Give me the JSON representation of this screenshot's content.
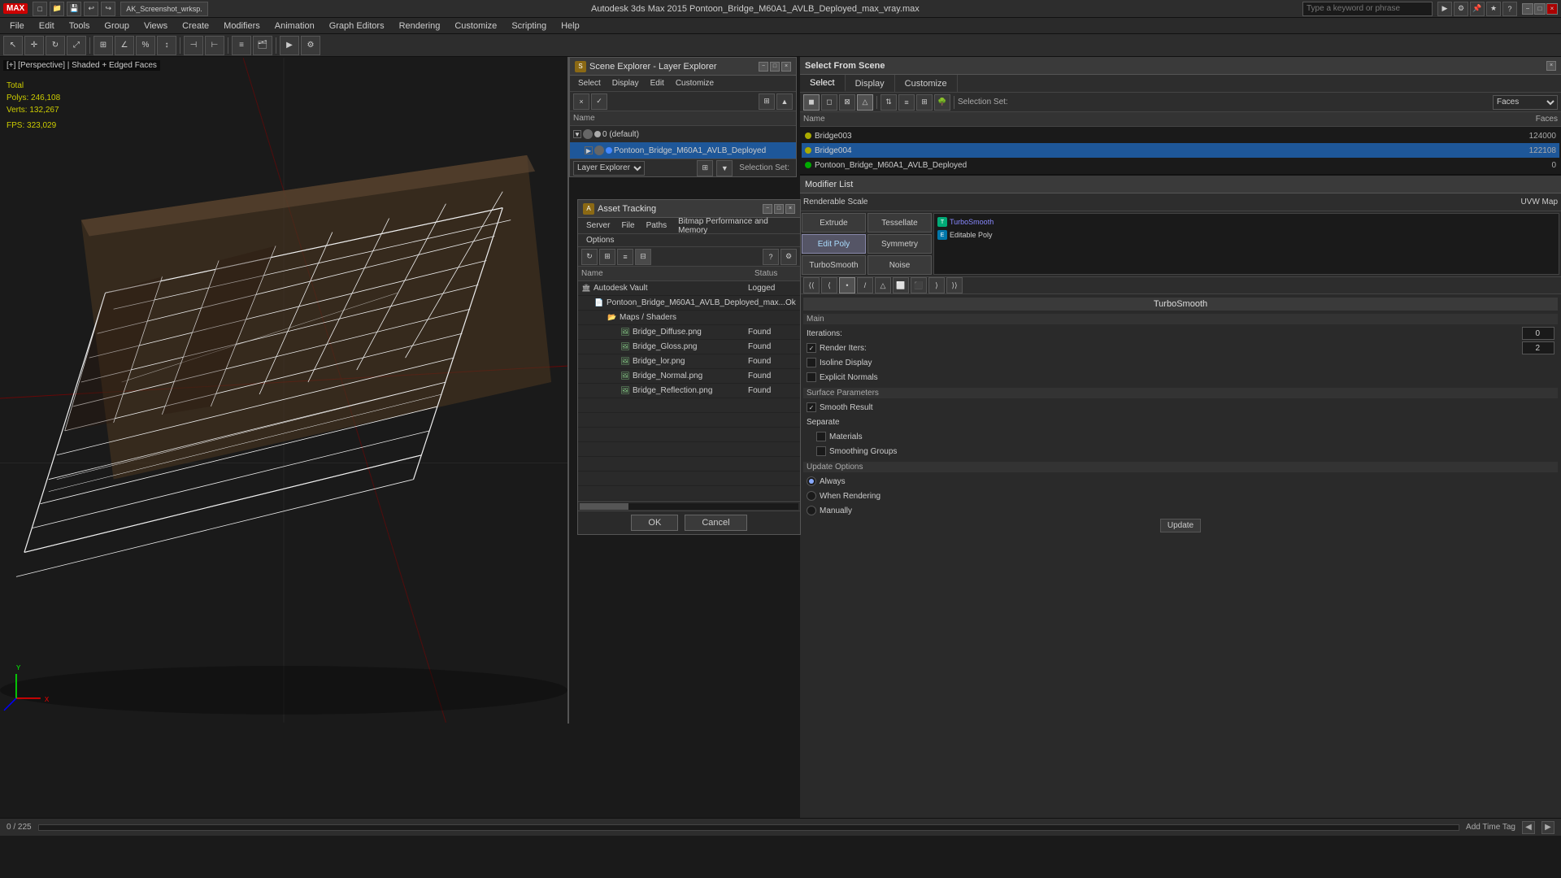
{
  "topbar": {
    "logo": "MAX",
    "title": "Autodesk 3ds Max 2015    Pontoon_Bridge_M60A1_AVLB_Deployed_max_vray.max",
    "search_placeholder": "Type a keyword or phrase",
    "file_tab": "AK_Screenshot_wrksp.",
    "min_label": "−",
    "max_label": "□",
    "close_label": "×"
  },
  "menubar": {
    "items": [
      "File",
      "Edit",
      "Tools",
      "Group",
      "Views",
      "Create",
      "Modifiers",
      "Animation",
      "Graph Editors",
      "Rendering",
      "Customize",
      "Scripting",
      "Help"
    ]
  },
  "viewport": {
    "label": "[+] [Perspective] | Shaded + Edged Faces",
    "stats": {
      "total_label": "Total",
      "polys_label": "Polys:",
      "polys_value": "246,108",
      "verts_label": "Verts:",
      "verts_value": "132,267",
      "fps_label": "FPS:",
      "fps_value": "323,029"
    }
  },
  "scene_explorer": {
    "title": "Scene Explorer - Layer Explorer",
    "menus": [
      "Select",
      "Display",
      "Edit",
      "Customize"
    ],
    "columns": [
      "Name"
    ],
    "rows": [
      {
        "label": "0 (default)",
        "indent": 0,
        "expanded": true,
        "color": "#aaa"
      },
      {
        "label": "Pontoon_Bridge_M60A1_AVLB_Deployed",
        "indent": 1,
        "expanded": false,
        "selected": true,
        "color": "#4488ff"
      }
    ],
    "footer_label": "Layer Explorer",
    "selection_set_label": "Selection Set:"
  },
  "select_from_scene": {
    "title": "Select From Scene",
    "tabs": [
      "Select",
      "Display",
      "Customize"
    ],
    "active_tab": "Select",
    "filter_label": "Name",
    "filter_faces": "Faces",
    "columns": [
      "Name",
      "",
      ""
    ],
    "rows": [
      {
        "label": "Bridge003",
        "value": "124000",
        "dot": "yellow"
      },
      {
        "label": "Bridge004",
        "value": "122108",
        "dot": "yellow",
        "selected": true
      },
      {
        "label": "Pontoon_Bridge_M60A1_AVLB_Deployed",
        "value": "0",
        "dot": "green"
      }
    ]
  },
  "asset_tracking": {
    "title": "Asset Tracking",
    "menus": [
      "Server",
      "File",
      "Paths",
      "Bitmap Performance and Memory",
      "Options"
    ],
    "columns": [
      "Name",
      "Status"
    ],
    "rows": [
      {
        "label": "Autodesk Vault",
        "indent": 0,
        "status": "Logged",
        "type": "vault"
      },
      {
        "label": "Pontoon_Bridge_M60A1_AVLB_Deployed_max...",
        "indent": 1,
        "status": "Ok",
        "type": "file"
      },
      {
        "label": "Maps / Shaders",
        "indent": 2,
        "status": "",
        "type": "folder"
      },
      {
        "label": "Bridge_Diffuse.png",
        "indent": 3,
        "status": "Found",
        "type": "image"
      },
      {
        "label": "Bridge_Gloss.png",
        "indent": 3,
        "status": "Found",
        "type": "image"
      },
      {
        "label": "Bridge_lor.png",
        "indent": 3,
        "status": "Found",
        "type": "image"
      },
      {
        "label": "Bridge_Normal.png",
        "indent": 3,
        "status": "Found",
        "type": "image"
      },
      {
        "label": "Bridge_Reflection.png",
        "indent": 3,
        "status": "Found",
        "type": "image"
      }
    ],
    "ok_label": "OK",
    "cancel_label": "Cancel"
  },
  "modifier_panel": {
    "title": "Modifier List",
    "renderable_scale_label": "Renderable Scale",
    "uvw_map_label": "UVW Map",
    "buttons": [
      {
        "label": "Extrude",
        "active": false
      },
      {
        "label": "Tessellate",
        "active": false
      },
      {
        "label": "Edit Poly",
        "active": true
      },
      {
        "label": "Symmetry",
        "active": false
      },
      {
        "label": "TurboSmooth",
        "active": false
      },
      {
        "label": "Noise",
        "active": false
      }
    ],
    "stack": [
      {
        "label": "TurboSmooth",
        "icon": "T",
        "color": "green",
        "selected": false
      },
      {
        "label": "Editable Poly",
        "icon": "E",
        "color": "blue",
        "selected": false
      }
    ]
  },
  "turbosmooth": {
    "title": "TurboSmooth",
    "main_label": "Main",
    "iterations_label": "Iterations:",
    "iterations_value": "0",
    "render_iters_label": "Render Iters:",
    "render_iters_value": "2",
    "render_iters_checked": true,
    "isoline_label": "Isoline Display",
    "explicit_label": "Explicit Normals",
    "surface_params_label": "Surface Parameters",
    "smooth_result_label": "Smooth Result",
    "smooth_result_checked": true,
    "separate_label": "Separate",
    "materials_label": "Materials",
    "smoothing_groups_label": "Smoothing Groups",
    "update_label": "Update Options",
    "always_label": "Always",
    "when_rendering_label": "When Rendering",
    "manually_label": "Manually",
    "update_btn": "Update"
  },
  "statusbar": {
    "progress": "0 / 225",
    "addtime_label": "Add Time Tag"
  }
}
